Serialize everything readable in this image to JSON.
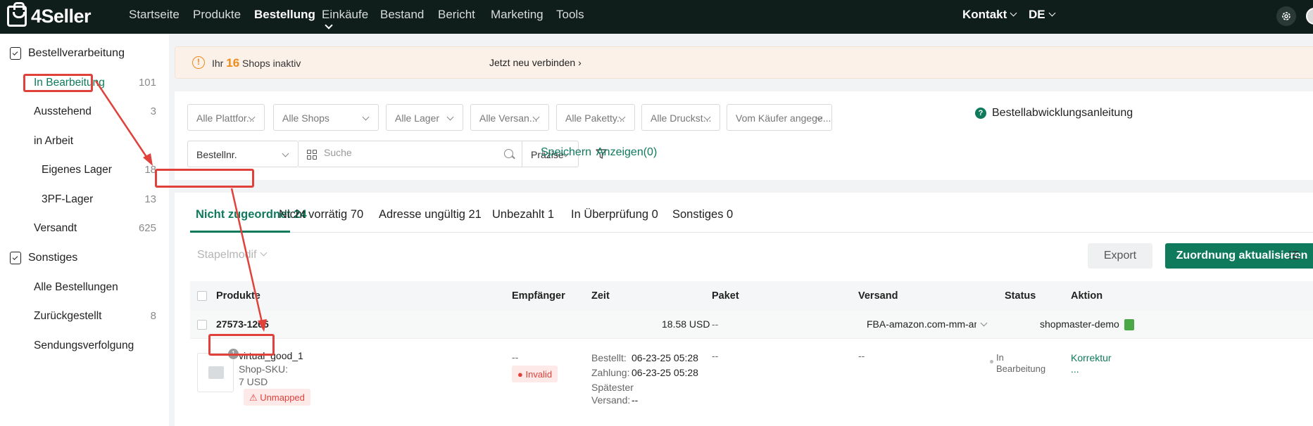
{
  "brand": {
    "name": "4Seller"
  },
  "nav": {
    "items": [
      "Startseite",
      "Produkte",
      "Bestellung",
      "Einkäufe",
      "Bestand",
      "Bericht",
      "Marketing",
      "Tools"
    ],
    "active": "Bestellung",
    "contact": "Kontakt",
    "language": "DE"
  },
  "sidebar": {
    "group1": "Bestellverarbeitung",
    "items1": [
      {
        "label": "In Bearbeitung",
        "count": "101"
      },
      {
        "label": "Ausstehend",
        "count": "3"
      },
      {
        "label": "in Arbeit",
        "count": ""
      },
      {
        "label": "Eigenes Lager",
        "count": "18"
      },
      {
        "label": "3PF-Lager",
        "count": "13"
      },
      {
        "label": "Versandt",
        "count": "625"
      }
    ],
    "group2": "Sonstiges",
    "items2": [
      {
        "label": "Alle Bestellungen",
        "count": ""
      },
      {
        "label": "Zurückgestellt",
        "count": "8"
      },
      {
        "label": "Sendungsverfolgung",
        "count": ""
      }
    ]
  },
  "alert": {
    "prefix": "Ihr",
    "count": "16",
    "suffix": "Shops inaktiv",
    "link": "Jetzt neu verbinden"
  },
  "filters": {
    "selects": [
      "Alle Plattfor...",
      "Alle Shops",
      "Alle Lager",
      "Alle Versan...",
      "Alle Paketty...",
      "Alle Druckst...",
      "Vom Käufer angege..."
    ],
    "search_field": "Bestellnr.",
    "search_placeholder": "Suche",
    "precision": "Präzise",
    "save": "Speichern",
    "show": "Anzeigen(0)",
    "guide": "Bestellabwicklungsanleitung"
  },
  "tabs": [
    {
      "label": "Nicht zugeordnet 24"
    },
    {
      "label": "Nicht vorrätig 70"
    },
    {
      "label": "Adresse ungültig 21"
    },
    {
      "label": "Unbezahlt 1"
    },
    {
      "label": "In Überprüfung 0"
    },
    {
      "label": "Sonstiges 0"
    }
  ],
  "toolbar": {
    "batch": "Stapelmodif",
    "export": "Export",
    "update_mapping": "Zuordnung aktualisieren"
  },
  "table": {
    "columns": [
      "Produkte",
      "Empfänger",
      "Zeit",
      "Paket",
      "Versand",
      "Status",
      "Aktion"
    ],
    "order": {
      "id": "27573-1265",
      "amount": "18.58 USD",
      "paket": "--",
      "versand": "FBA-amazon.com-mm-amaz",
      "shop": "shopmaster-demo"
    },
    "item": {
      "qty_badge": "1",
      "name": "virtual_good_1",
      "shop_sku": "Shop-SKU:",
      "price": "7 USD",
      "unmapped": "Unmapped",
      "recipient": "--",
      "invalid": "Invalid",
      "ordered_label": "Bestellt:",
      "ordered_value": "06-23-25 05:28",
      "payment_label": "Zahlung:",
      "payment_value": "06-23-25 05:28",
      "latest_label": "Spätester",
      "latest_label2": "Versand:",
      "latest_value": "--",
      "paket": "--",
      "versand": "--",
      "status1": "In",
      "status2": "Bearbeitung",
      "action1": "Korrektur",
      "action2": "..."
    }
  },
  "colors": {
    "brand_green": "#0f7a5c",
    "annotation_red": "#e0413a",
    "alert_orange": "#f08a1a"
  }
}
